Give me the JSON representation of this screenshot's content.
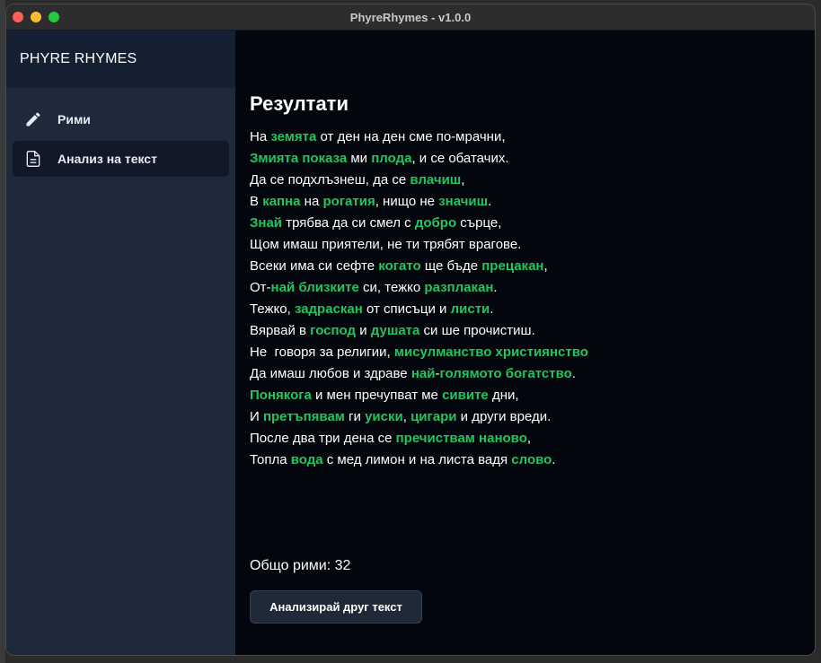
{
  "window": {
    "title": "PhyreRhymes - v1.0.0"
  },
  "sidebar": {
    "brand": "PHYRE RHYMES",
    "items": [
      {
        "label": "Рими",
        "icon": "pencil-icon",
        "active": false
      },
      {
        "label": "Анализ на текст",
        "icon": "document-icon",
        "active": true
      }
    ]
  },
  "main": {
    "title": "Резултати",
    "poem": [
      [
        [
          "На ",
          false
        ],
        [
          "земята",
          true
        ],
        [
          " от ден на ден сме по-мрачни,",
          false
        ]
      ],
      [
        [
          "Змията показа",
          true
        ],
        [
          " ми ",
          false
        ],
        [
          "плода",
          true
        ],
        [
          ", и се обатачих.",
          false
        ]
      ],
      [
        [
          "Да се подхлъзнеш, да се ",
          false
        ],
        [
          "влачиш",
          true
        ],
        [
          ",",
          false
        ]
      ],
      [
        [
          "В ",
          false
        ],
        [
          "капна",
          true
        ],
        [
          " на ",
          false
        ],
        [
          "рогатия",
          true
        ],
        [
          ", нищо не ",
          false
        ],
        [
          "значиш",
          true
        ],
        [
          ".",
          false
        ]
      ],
      [
        [
          "Знай",
          true
        ],
        [
          " трябва да си смел с ",
          false
        ],
        [
          "добро",
          true
        ],
        [
          " сърце,",
          false
        ]
      ],
      [
        [
          "Щом имаш приятели, не ти трябят врагове.",
          false
        ]
      ],
      [
        [
          "Всеки има си сефте ",
          false
        ],
        [
          "когато",
          true
        ],
        [
          " ще бъде ",
          false
        ],
        [
          "прецакан",
          true
        ],
        [
          ",",
          false
        ]
      ],
      [
        [
          "От-",
          false
        ],
        [
          "най близките",
          true
        ],
        [
          " си, тежко ",
          false
        ],
        [
          "разплакан",
          true
        ],
        [
          ".",
          false
        ]
      ],
      [
        [
          "Тежко, ",
          false
        ],
        [
          "задраскан",
          true
        ],
        [
          " от списъци и ",
          false
        ],
        [
          "листи",
          true
        ],
        [
          ".",
          false
        ]
      ],
      [
        [
          "Вярвай в ",
          false
        ],
        [
          "господ",
          true
        ],
        [
          " и ",
          false
        ],
        [
          "душата",
          true
        ],
        [
          " си ше прочистиш.",
          false
        ]
      ],
      [
        [
          "Не  говоря за религии, ",
          false
        ],
        [
          "мисулманство християнство",
          true
        ]
      ],
      [
        [
          "Да имаш любов и здраве ",
          false
        ],
        [
          "най",
          true
        ],
        [
          "-",
          false
        ],
        [
          "голямото богатство",
          true
        ],
        [
          ".",
          false
        ]
      ],
      [
        [
          "Понякога",
          true
        ],
        [
          " и мен пречупват ме ",
          false
        ],
        [
          "сивите",
          true
        ],
        [
          " дни,",
          false
        ]
      ],
      [
        [
          "И ",
          false
        ],
        [
          "претъпявам",
          true
        ],
        [
          " ги ",
          false
        ],
        [
          "уиски",
          true
        ],
        [
          ", ",
          false
        ],
        [
          "цигари",
          true
        ],
        [
          " и други вреди.",
          false
        ]
      ],
      [
        [
          "После два три дена се ",
          false
        ],
        [
          "пречиствам наново",
          true
        ],
        [
          ",",
          false
        ]
      ],
      [
        [
          "Топла ",
          false
        ],
        [
          "вода",
          true
        ],
        [
          " с мед лимон и на листа вадя ",
          false
        ],
        [
          "слово",
          true
        ],
        [
          ".",
          false
        ]
      ]
    ],
    "total_label": "Общо рими: 32",
    "analyze_button": "Анализирай друг текст"
  },
  "colors": {
    "accent_green": "#22c55e",
    "sidebar_bg": "#1e293b",
    "main_bg": "#03060d"
  }
}
